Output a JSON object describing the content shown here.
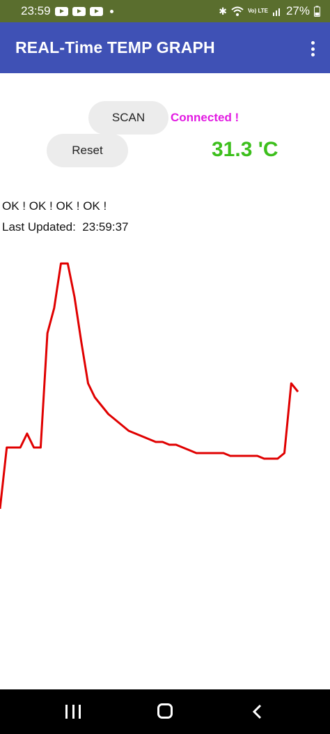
{
  "status_bar": {
    "time": "23:59",
    "battery": "27%",
    "network_label": "Vo) LTE"
  },
  "app_bar": {
    "title": "REAL-Time TEMP GRAPH"
  },
  "controls": {
    "scan_label": "SCAN",
    "reset_label": "Reset",
    "connection_status": "Connected !",
    "temperature": "31.3 'C"
  },
  "status": {
    "ok_messages": "OK ! OK ! OK ! OK !",
    "last_updated": "Last Updated:  23:59:37"
  },
  "colors": {
    "app_bar": "#3f51b5",
    "status_bar": "#5a6e2e",
    "connected": "#e21be2",
    "temperature": "#3cbf1c",
    "graph_line": "#e00000"
  },
  "chart_data": {
    "type": "line",
    "title": "",
    "xlabel": "",
    "ylabel": "",
    "grid": false,
    "series": [
      {
        "x": [
          0,
          1,
          2,
          3,
          4,
          5,
          6,
          7,
          8,
          9,
          10,
          11,
          12,
          13,
          14,
          15,
          16,
          17,
          18,
          19,
          20,
          21,
          22,
          23,
          24,
          25,
          26,
          27,
          28,
          29,
          30,
          31,
          32,
          33,
          34,
          35,
          36,
          37,
          38,
          39,
          40,
          41,
          42,
          43,
          44
        ],
        "y": [
          0.1,
          0.32,
          0.32,
          0.32,
          0.37,
          0.32,
          0.32,
          0.73,
          0.82,
          0.98,
          0.98,
          0.86,
          0.7,
          0.55,
          0.5,
          0.47,
          0.44,
          0.42,
          0.4,
          0.38,
          0.37,
          0.36,
          0.35,
          0.34,
          0.34,
          0.33,
          0.33,
          0.32,
          0.31,
          0.3,
          0.3,
          0.3,
          0.3,
          0.3,
          0.29,
          0.29,
          0.29,
          0.29,
          0.29,
          0.28,
          0.28,
          0.28,
          0.3,
          0.55,
          0.52
        ]
      }
    ]
  }
}
